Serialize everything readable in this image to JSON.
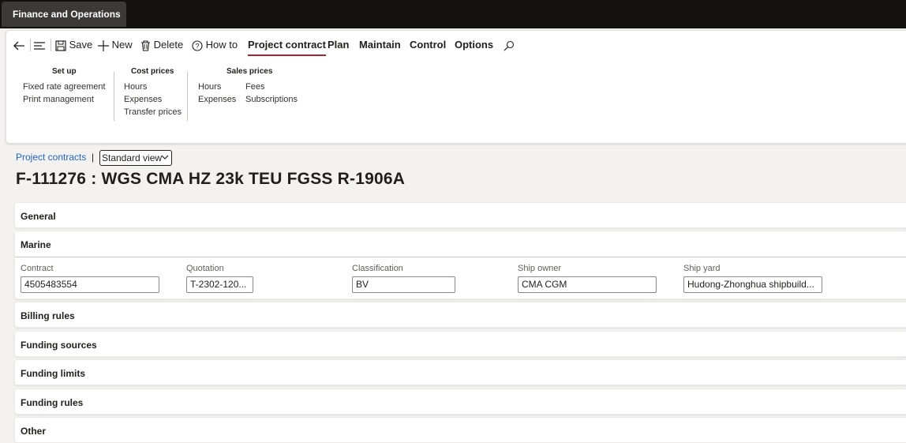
{
  "app": {
    "title": "Finance and Operations"
  },
  "toolbar": {
    "save_label": "Save",
    "new_label": "New",
    "delete_label": "Delete",
    "howto_label": "How to",
    "tabs": [
      {
        "label": "Project contract"
      },
      {
        "label": "Plan"
      },
      {
        "label": "Maintain"
      },
      {
        "label": "Control"
      },
      {
        "label": "Options"
      }
    ]
  },
  "ribbon": {
    "groups": [
      {
        "title": "Set up",
        "items": [
          "Fixed rate agreement",
          "Print management"
        ]
      },
      {
        "title": "Cost prices",
        "items": [
          "Hours",
          "Expenses",
          "Transfer prices"
        ]
      },
      {
        "title": "Sales prices",
        "items": [
          "Hours",
          "Expenses",
          "Fees",
          "Subscriptions"
        ]
      }
    ]
  },
  "breadcrumb": {
    "link": "Project contracts",
    "separator": "|",
    "view": "Standard view"
  },
  "page": {
    "title": "F-111276 : WGS CMA HZ 23k TEU FGSS R-1906A"
  },
  "sections": [
    {
      "label": "General"
    },
    {
      "label": "Marine"
    },
    {
      "label": "Billing rules"
    },
    {
      "label": "Funding sources"
    },
    {
      "label": "Funding limits"
    },
    {
      "label": "Funding rules"
    },
    {
      "label": "Other"
    }
  ],
  "marine": {
    "fields": [
      {
        "label": "Contract",
        "value": "4505483554"
      },
      {
        "label": "Quotation",
        "value": "T-2302-120..."
      },
      {
        "label": "Classification",
        "value": "BV"
      },
      {
        "label": "Ship owner",
        "value": "CMA CGM"
      },
      {
        "label": "Ship yard",
        "value": "Hudong-Zhonghua shipbuild..."
      }
    ]
  },
  "colors": {
    "topbar": "#141210",
    "accent_underline": "#a4262c",
    "link": "#2266c4"
  }
}
